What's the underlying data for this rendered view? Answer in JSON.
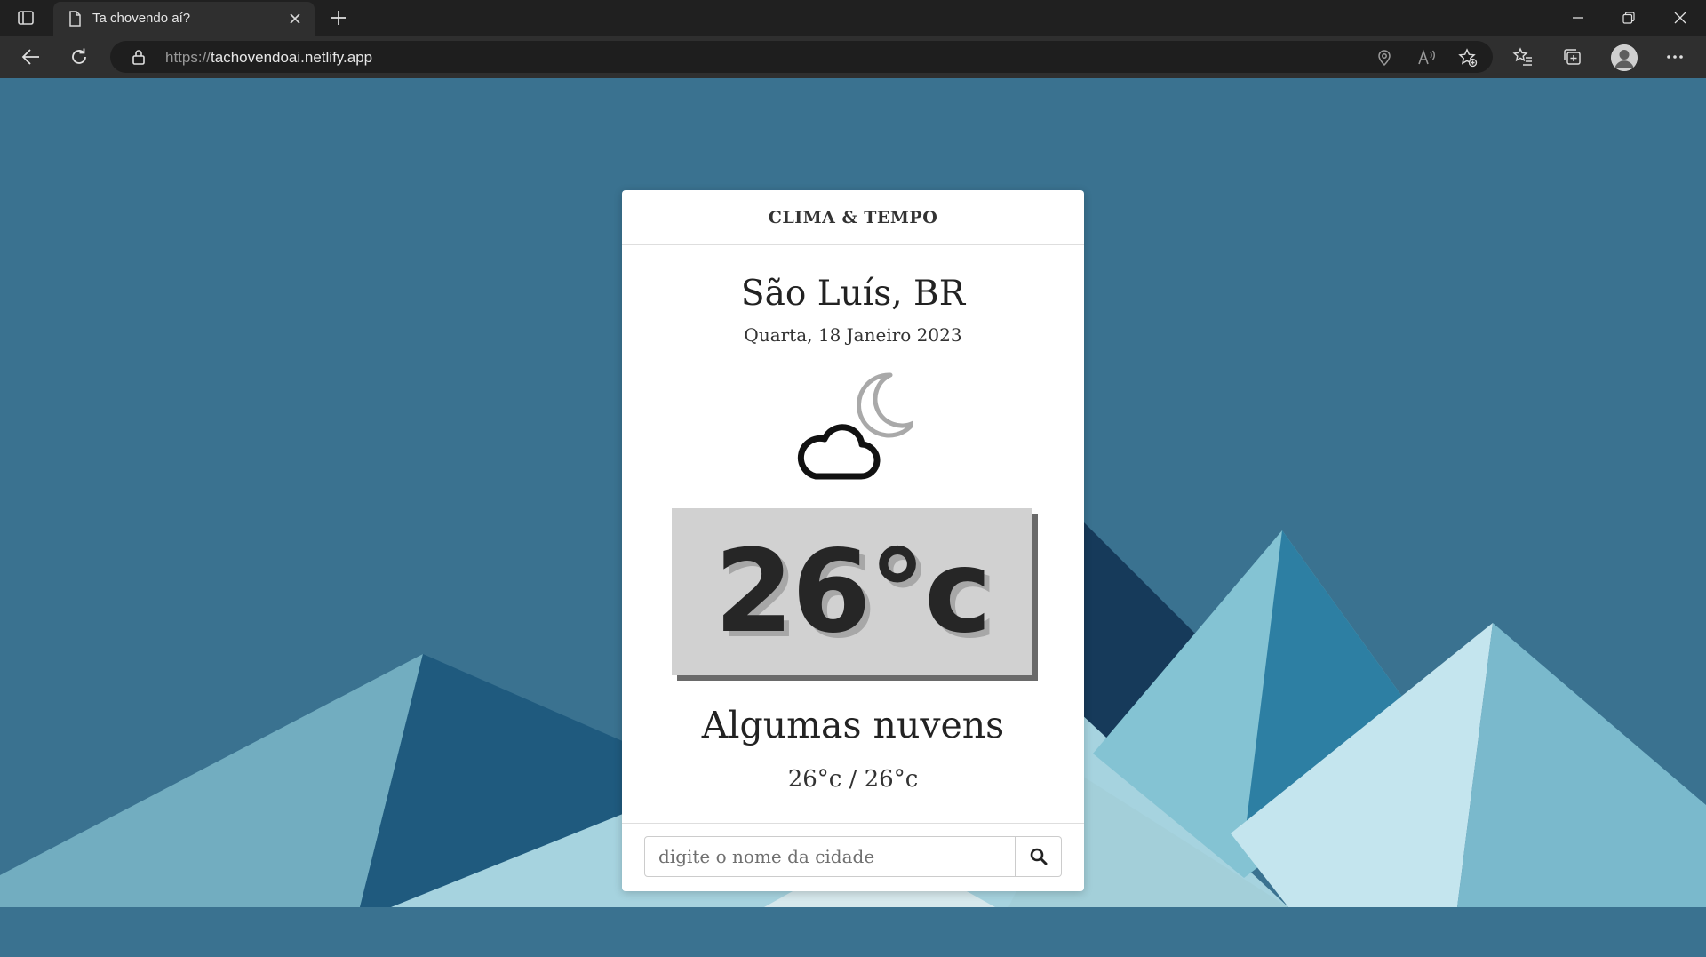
{
  "browser": {
    "tab_title": "Ta chovendo aí?",
    "url_protocol": "https://",
    "url_host": "tachovendoai.netlify.app",
    "icons": [
      "tab-actions-icon",
      "page-icon",
      "close-icon",
      "plus-icon",
      "minimize-icon",
      "restore-icon",
      "window-close-icon",
      "back-arrow-icon",
      "refresh-icon",
      "lock-icon",
      "location-icon",
      "read-aloud-icon",
      "add-favorite-icon",
      "favorites-icon",
      "collections-icon",
      "profile-icon",
      "more-icon"
    ]
  },
  "app": {
    "brand": "CLIMA & TEMPO",
    "city": "São Luís, BR",
    "date": "Quarta, 18 Janeiro 2023",
    "weather_icon": "cloud-moon-icon",
    "temperature": "26°c",
    "condition": "Algumas nuvens",
    "min_max": "26°c / 26°c",
    "search": {
      "placeholder": "digite o nome da cidade",
      "value": ""
    }
  },
  "colors": {
    "background": "#3a7290",
    "card": "#ffffff",
    "temp_box": "#d1d1d1",
    "temp_shadow": "#6a6a6a"
  }
}
